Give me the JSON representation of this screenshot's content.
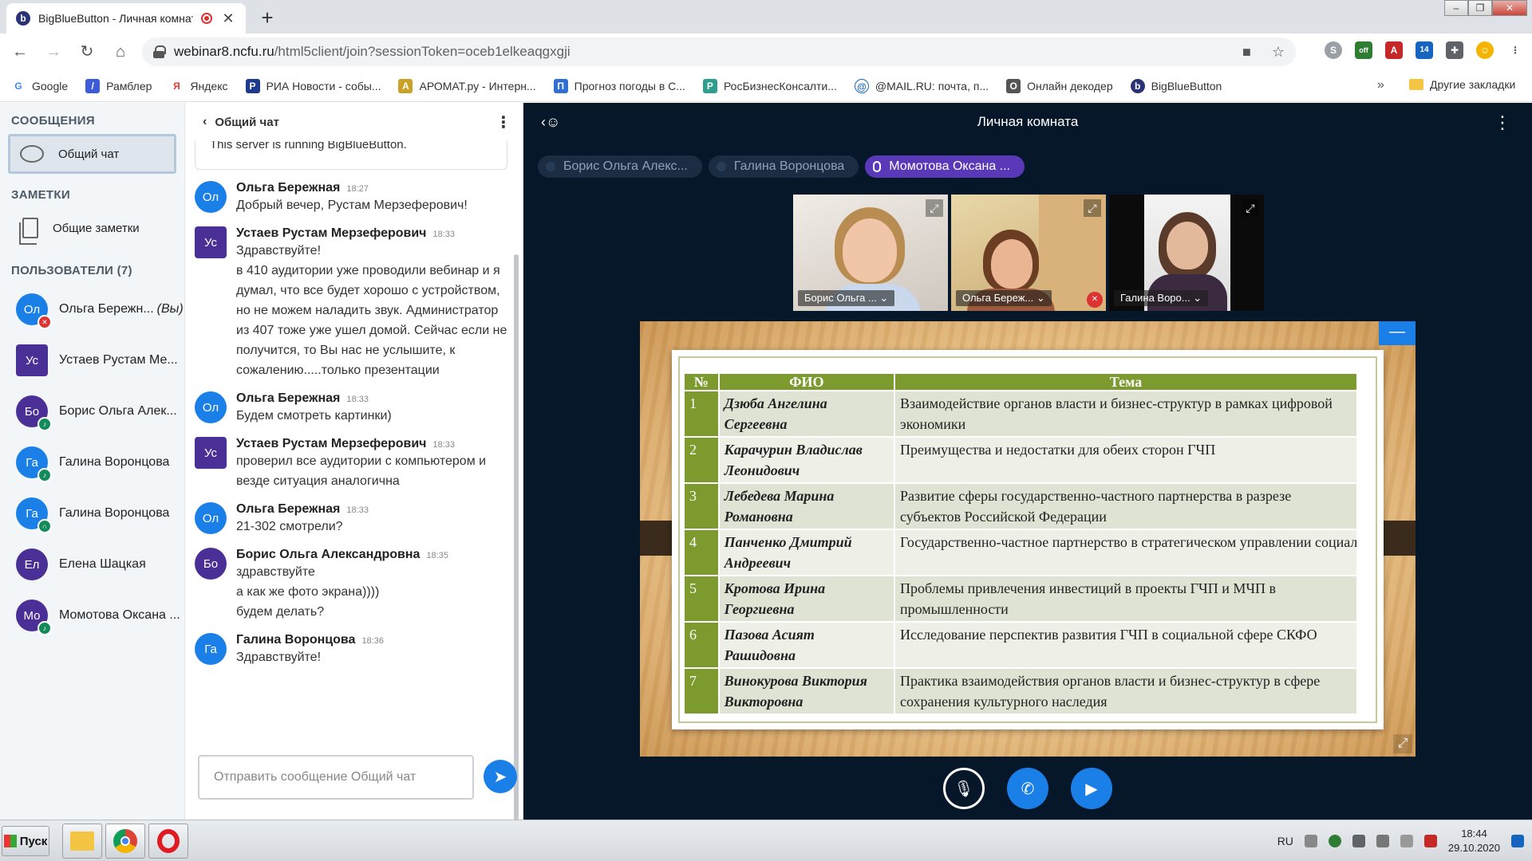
{
  "browser": {
    "tab_title": "BigBlueButton - Личная комната",
    "favicon": "b",
    "url_host": "webinar8.ncfu.ru",
    "url_path": "/html5client/join?sessionToken=oceb1elkeaqgxgji",
    "bookmarks": [
      {
        "label": "Google",
        "icon": "G",
        "color": "#4285f4"
      },
      {
        "label": "Рамблер",
        "icon": "/",
        "color": "#3b5bdb"
      },
      {
        "label": "Яндекс",
        "icon": "Я",
        "color": "#e53935"
      },
      {
        "label": "РИА Новости - собы...",
        "icon": "Р",
        "color": "#1f3b8f"
      },
      {
        "label": "АРОМАТ.ру - Интерн...",
        "icon": "А",
        "color": "#c9a227"
      },
      {
        "label": "Прогноз погоды в С...",
        "icon": "П",
        "color": "#2f6fd6"
      },
      {
        "label": "РосБизнесКонсалти...",
        "icon": "Р",
        "color": "#2f9e8f"
      },
      {
        "label": "@MAIL.RU: почта, п...",
        "icon": "@",
        "color": "#1565c0"
      },
      {
        "label": "Онлайн декодер",
        "icon": "О",
        "color": "#555555"
      },
      {
        "label": "BigBlueButton",
        "icon": "b",
        "color": "#283274"
      }
    ],
    "bookmarks_more": "»",
    "other_bookmarks": "Другие закладки",
    "extension_badge": "14",
    "extension_off": "off"
  },
  "leftnav": {
    "messages_header": "СООБЩЕНИЯ",
    "public_chat": "Общий чат",
    "notes_header": "ЗАМЕТКИ",
    "shared_notes": "Общие заметки",
    "users_header": "ПОЛЬЗОВАТЕЛИ (7)",
    "users": [
      {
        "initials": "Ол",
        "name": "Ольга Бережн...",
        "you": "(Вы)",
        "color": "#1b7fe8",
        "badge_color": "#d33",
        "square": false
      },
      {
        "initials": "Ус",
        "name": "Устаев Рустам Ме...",
        "you": "",
        "color": "#4a2f97",
        "badge_color": "",
        "square": true
      },
      {
        "initials": "Бо",
        "name": "Борис Ольга Алек...",
        "you": "",
        "color": "#4a2f97",
        "badge_color": "#138a5a",
        "square": false
      },
      {
        "initials": "Га",
        "name": "Галина Воронцова",
        "you": "",
        "color": "#1b7fe8",
        "badge_color": "#138a5a",
        "square": false
      },
      {
        "initials": "Га",
        "name": "Галина Воронцова",
        "you": "",
        "color": "#1b7fe8",
        "badge_color": "#138a5a",
        "square": false
      },
      {
        "initials": "Ел",
        "name": "Елена Шацкая",
        "you": "",
        "color": "#4a2f97",
        "badge_color": "",
        "square": false
      },
      {
        "initials": "Мо",
        "name": "Момотова Оксана ...",
        "you": "",
        "color": "#4a2f97",
        "badge_color": "#138a5a",
        "square": false
      }
    ]
  },
  "chat": {
    "title": "Общий чат",
    "server_line": "This server is running BigBlueButton.",
    "placeholder": "Отправить сообщение Общий чат",
    "messages": [
      {
        "initials": "Ол",
        "color": "#1b7fe8",
        "name": "Ольга Бережная",
        "time": "18:27",
        "lines": [
          "Добрый вечер, Рустам Мерзеферович!"
        ]
      },
      {
        "initials": "Ус",
        "color": "#4a2f97",
        "name": "Устаев Рустам Мерзеферович",
        "time": "18:33",
        "lines": [
          "Здравствуйте!",
          "в 410 аудитории уже проводили вебинар и я думал, что все будет хорошо с устройством, но не можем наладить звук. Администратор из 407 тоже уже ушел домой. Сейчас если не получится, то Вы нас не услышите, к сожалению.....только презентации"
        ]
      },
      {
        "initials": "Ол",
        "color": "#1b7fe8",
        "name": "Ольга Бережная",
        "time": "18:33",
        "lines": [
          "Будем смотреть картинки)"
        ]
      },
      {
        "initials": "Ус",
        "color": "#4a2f97",
        "name": "Устаев Рустам Мерзеферович",
        "time": "18:33",
        "lines": [
          "проверил все аудитории с компьютером и везде ситуация аналогична"
        ]
      },
      {
        "initials": "Ол",
        "color": "#1b7fe8",
        "name": "Ольга Бережная",
        "time": "18:33",
        "lines": [
          "21-302 смотрели?"
        ]
      },
      {
        "initials": "Бо",
        "color": "#4a2f97",
        "name": "Борис Ольга Александровна",
        "time": "18:35",
        "lines": [
          "здравствуйте",
          "а как же фото экрана))))",
          "будем делать?"
        ]
      },
      {
        "initials": "Га",
        "color": "#1b7fe8",
        "name": "Галина Воронцова",
        "time": "18:36",
        "lines": [
          "Здравствуйте!"
        ]
      }
    ]
  },
  "main": {
    "room_title": "Личная комната",
    "talkers": [
      {
        "name": "Борис Ольга Алекс...",
        "active": false
      },
      {
        "name": "Галина Воронцова",
        "active": false
      },
      {
        "name": "Момотова Оксана ...",
        "active": true
      }
    ],
    "videos": [
      {
        "name": "Борис Ольга ... ⌄",
        "muted": false
      },
      {
        "name": "Ольга Береж... ⌄",
        "muted": true
      },
      {
        "name": "Галина Воро... ⌄",
        "muted": false
      }
    ],
    "slide": {
      "headers": [
        "№",
        "ФИО",
        "Тема"
      ],
      "rows": [
        {
          "num": "1",
          "fio": "Дзюба Ангелина Сергеевна",
          "topic": "Взаимодействие органов власти и бизнес-структур в рамках цифровой экономики"
        },
        {
          "num": "2",
          "fio": "Карачурин Владислав Леонидович",
          "topic": "Преимущества и недостатки для обеих сторон ГЧП"
        },
        {
          "num": "3",
          "fio": "Лебедева Марина Романовна",
          "topic": "Развитие сферы государственно-частного партнерства в разрезе субъектов Российской Федерации"
        },
        {
          "num": "4",
          "fio": "Панченко Дмитрий Андреевич",
          "topic": "Государственно-частное партнерство в стратегическом управлении социально-экономическим развитием Ставропольского края"
        },
        {
          "num": "5",
          "fio": "Кротова Ирина Георгиевна",
          "topic": "Проблемы привлечения инвестиций в проекты ГЧП и МЧП в промышленности"
        },
        {
          "num": "6",
          "fio": "Пазова Асият Рашидовна",
          "topic": "Исследование перспектив развития ГЧП в социальной сфере СКФО"
        },
        {
          "num": "7",
          "fio": "Винокурова Виктория Викторовна",
          "topic": "Практика взаимодействия органов власти и бизнес-структур в сфере сохранения культурного наследия"
        }
      ]
    }
  },
  "taskbar": {
    "start_label": "Пуск",
    "lang": "RU",
    "time": "18:44",
    "date": "29.10.2020"
  }
}
